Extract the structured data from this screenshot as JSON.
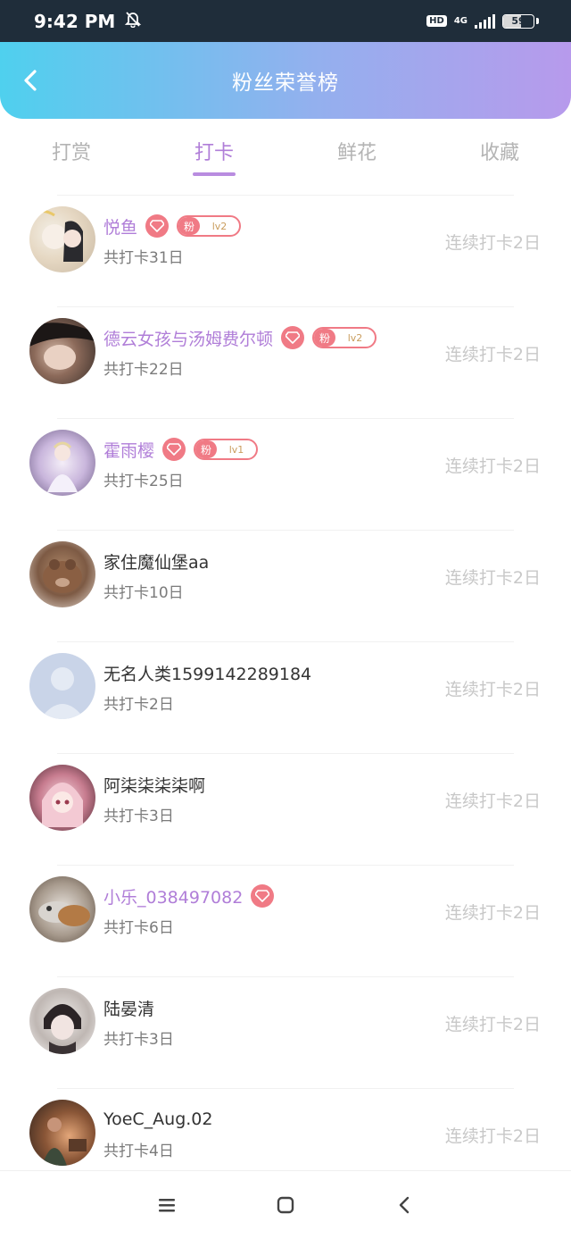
{
  "status_bar": {
    "time": "9:42 PM",
    "hd": "HD",
    "network": "4G",
    "battery": "59",
    "battery_level": 0.59
  },
  "header": {
    "title": "粉丝荣誉榜"
  },
  "tabs": [
    {
      "label": "打赏",
      "active": false
    },
    {
      "label": "打卡",
      "active": true
    },
    {
      "label": "鲜花",
      "active": false
    },
    {
      "label": "收藏",
      "active": false
    }
  ],
  "badge": {
    "fan_label": "粉"
  },
  "colors": {
    "accent": "#b07ed8",
    "badge": "#f07a85",
    "header_start": "#4fd0ee",
    "header_end": "#b79aec"
  },
  "list": [
    {
      "name": "悦鱼",
      "sub": "共打卡31日",
      "streak": "连续打卡2日",
      "level": "lv2"
    },
    {
      "name": "德云女孩与汤姆费尔顿",
      "sub": "共打卡22日",
      "streak": "连续打卡2日",
      "level": "lv2"
    },
    {
      "name": "霍雨樱",
      "sub": "共打卡25日",
      "streak": "连续打卡2日",
      "level": "lv1"
    },
    {
      "name": "家住魔仙堡aa",
      "sub": "共打卡10日",
      "streak": "连续打卡2日"
    },
    {
      "name": "无名人类1599142289184",
      "sub": "共打卡2日",
      "streak": "连续打卡2日"
    },
    {
      "name": "阿柒柒柒柒啊",
      "sub": "共打卡3日",
      "streak": "连续打卡2日"
    },
    {
      "name": "小乐_038497082",
      "sub": "共打卡6日",
      "streak": "连续打卡2日"
    },
    {
      "name": "陆晏清",
      "sub": "共打卡3日",
      "streak": "连续打卡2日"
    },
    {
      "name": "YoeC_Aug.02",
      "sub": "共打卡4日",
      "streak": "连续打卡2日"
    }
  ]
}
